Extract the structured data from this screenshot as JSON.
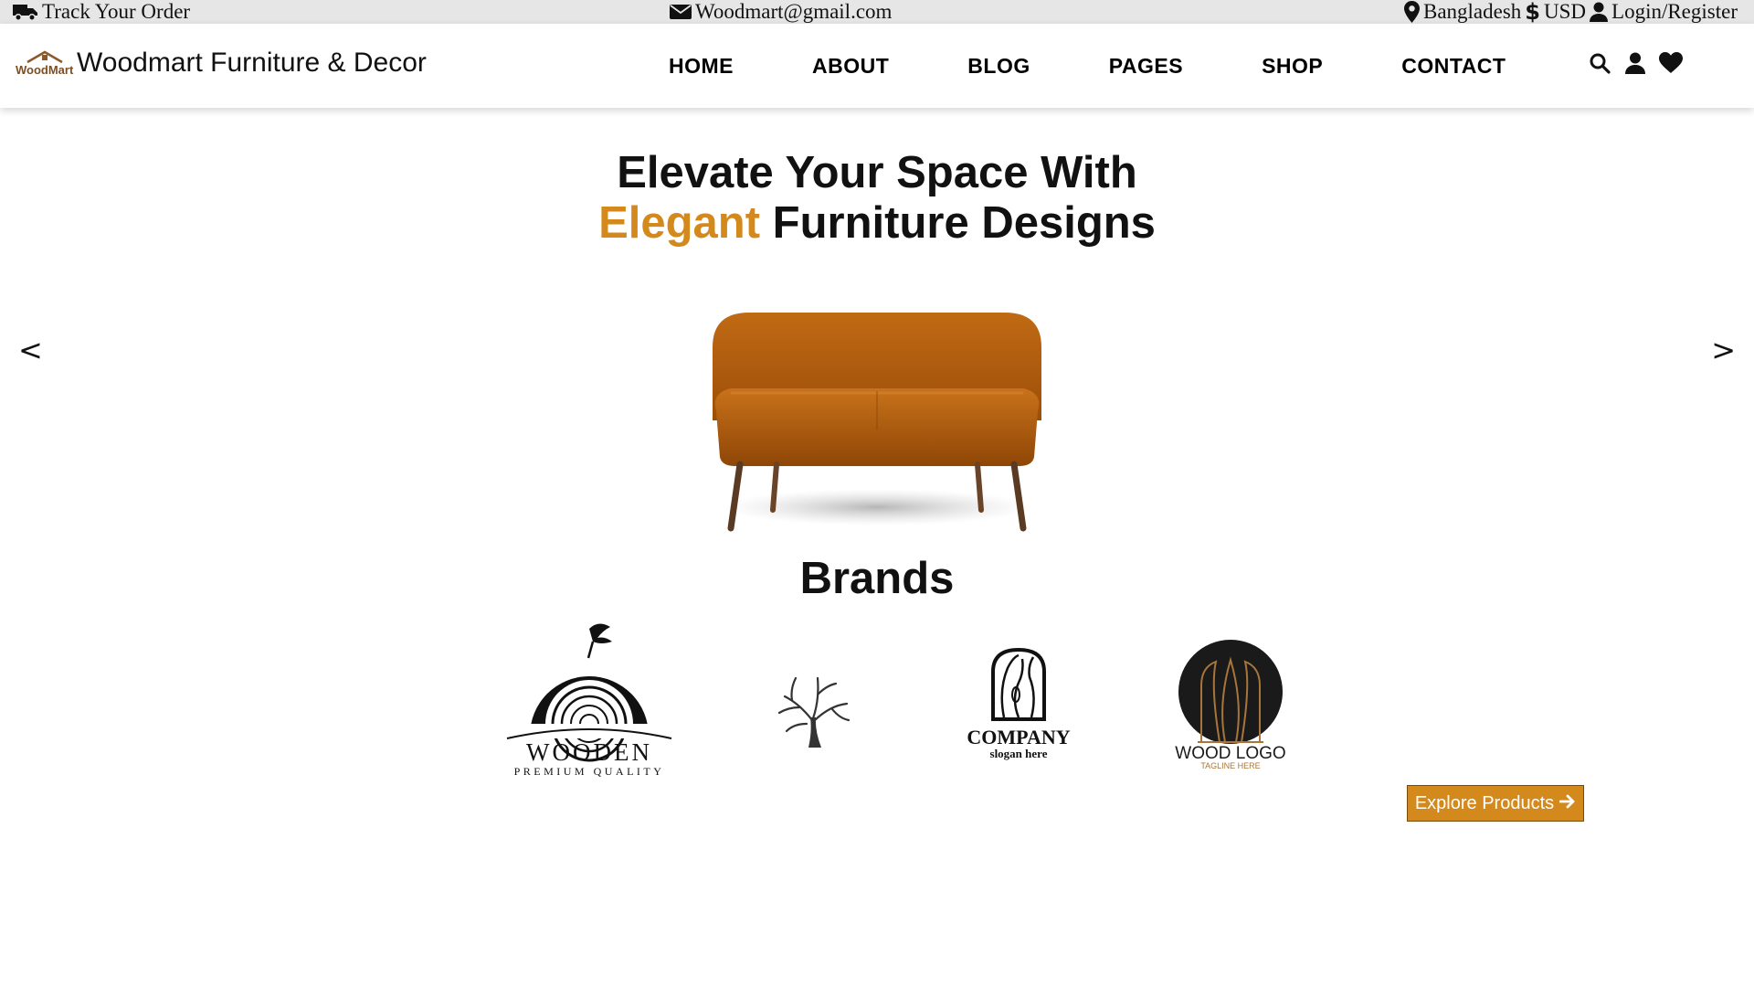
{
  "topbar": {
    "track_label": "Track Your Order",
    "email": "Woodmart@gmail.com",
    "location": "Bangladesh",
    "currency": "USD",
    "login_label": "Login/Register",
    "icons": [
      "truck-icon",
      "envelope-icon",
      "map-pin-icon",
      "dollar-icon",
      "user-icon"
    ]
  },
  "header": {
    "logo_text": "WoodMart",
    "brand_name": "Woodmart Furniture & Decor",
    "nav": [
      "HOME",
      "ABOUT",
      "BLOG",
      "PAGES",
      "SHOP",
      "CONTACT"
    ],
    "icons": [
      "search-icon",
      "user-icon",
      "heart-icon"
    ]
  },
  "hero": {
    "title_line1": "Elevate Your Space With",
    "title_accent": "Elegant",
    "title_line2_rest": " Furniture Designs",
    "prev": "<",
    "next": ">"
  },
  "brands": {
    "title": "Brands",
    "logos": [
      {
        "name": "WOODEN",
        "tagline": "PREMIUM QUALITY"
      },
      {
        "name": "tree-logo"
      },
      {
        "name": "COMPANY",
        "tagline": "slogan here"
      },
      {
        "name": "WOOD LOGO",
        "tagline": "TAGLINE HERE"
      }
    ]
  },
  "cta": {
    "explore_label": "Explore Products"
  },
  "colors": {
    "accent": "#d4891c",
    "topbar_bg": "#e6e6e6",
    "sofa": "#b8620f"
  }
}
